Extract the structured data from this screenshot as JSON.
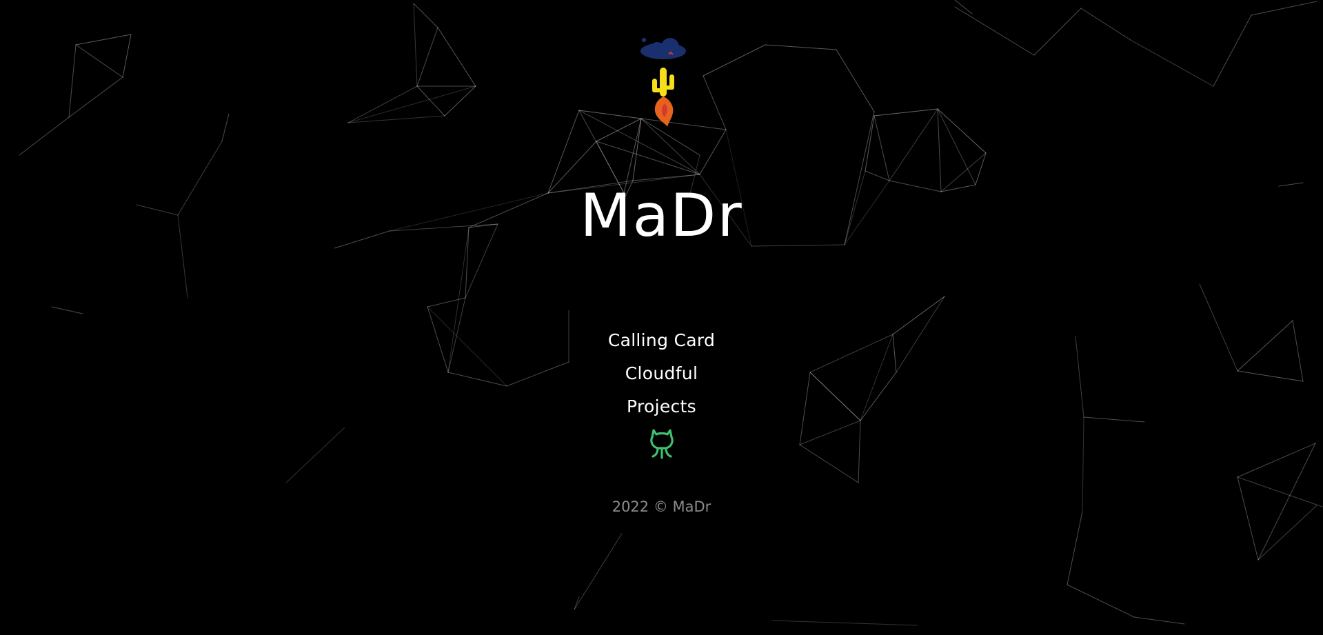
{
  "site": {
    "title": "MaDr"
  },
  "nav": {
    "items": [
      {
        "label": "Calling Card"
      },
      {
        "label": "Cloudful"
      },
      {
        "label": "Projects"
      }
    ]
  },
  "footer": {
    "text": "2022 © MaDr"
  },
  "icons": {
    "logo": "cloud-cactus-rocket-logo",
    "github": "github-octocat-icon"
  },
  "colors": {
    "background": "#000000",
    "text": "#ffffff",
    "footer_text": "#8c8c8c",
    "cloud": "#1a2f6e",
    "cactus": "#f6df1a",
    "flame": "#e5621f",
    "flame_inner": "#d9382c",
    "github_icon": "#3fbf6f",
    "network_lines": "#ffffff"
  }
}
